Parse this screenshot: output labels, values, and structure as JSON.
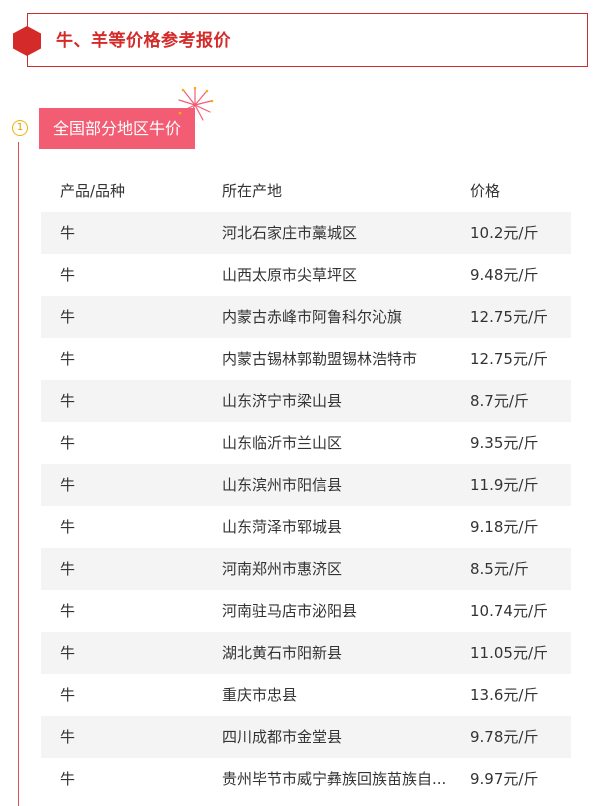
{
  "header": {
    "title": "牛、羊等价格参考报价",
    "accent_color": "#d42a2a",
    "icon": "hexagon-icon"
  },
  "section": {
    "step": "1",
    "label": "全国部分地区牛价",
    "tag_color": "#f25d73"
  },
  "table": {
    "columns": [
      "产品/品种",
      "所在产地",
      "价格"
    ],
    "rows": [
      {
        "product": "牛",
        "origin": "河北石家庄市藁城区",
        "price": "10.2元/斤"
      },
      {
        "product": "牛",
        "origin": "山西太原市尖草坪区",
        "price": "9.48元/斤"
      },
      {
        "product": "牛",
        "origin": "内蒙古赤峰市阿鲁科尔沁旗",
        "price": "12.75元/斤"
      },
      {
        "product": "牛",
        "origin": "内蒙古锡林郭勒盟锡林浩特市",
        "price": "12.75元/斤"
      },
      {
        "product": "牛",
        "origin": "山东济宁市梁山县",
        "price": "8.7元/斤"
      },
      {
        "product": "牛",
        "origin": "山东临沂市兰山区",
        "price": "9.35元/斤"
      },
      {
        "product": "牛",
        "origin": "山东滨州市阳信县",
        "price": "11.9元/斤"
      },
      {
        "product": "牛",
        "origin": "山东菏泽市郓城县",
        "price": "9.18元/斤"
      },
      {
        "product": "牛",
        "origin": "河南郑州市惠济区",
        "price": "8.5元/斤"
      },
      {
        "product": "牛",
        "origin": "河南驻马店市泌阳县",
        "price": "10.74元/斤"
      },
      {
        "product": "牛",
        "origin": "湖北黄石市阳新县",
        "price": "11.05元/斤"
      },
      {
        "product": "牛",
        "origin": "重庆市忠县",
        "price": "13.6元/斤"
      },
      {
        "product": "牛",
        "origin": "四川成都市金堂县",
        "price": "9.78元/斤"
      },
      {
        "product": "牛",
        "origin": "贵州毕节市威宁彝族回族苗族自...",
        "price": "9.97元/斤"
      }
    ]
  }
}
